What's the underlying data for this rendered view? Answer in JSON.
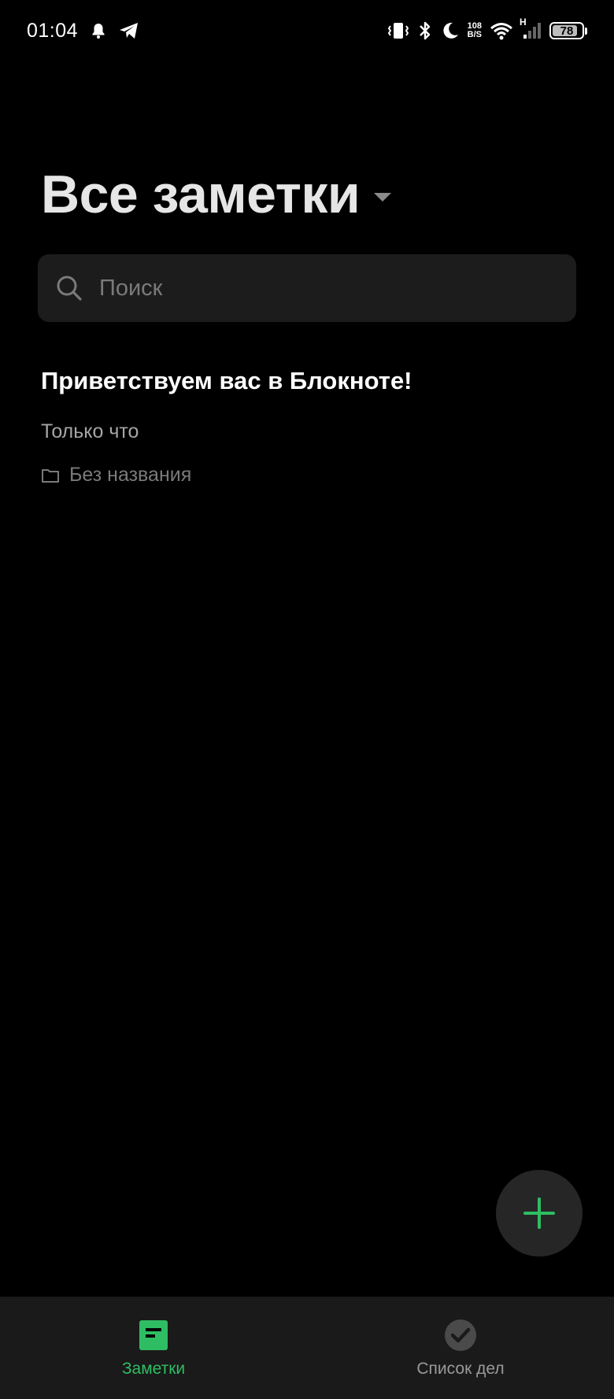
{
  "status_bar": {
    "time": "01:04",
    "net_speed_value": "108",
    "net_speed_unit": "B/S",
    "network_type": "H",
    "battery_level": "78",
    "icons": [
      "bell-icon",
      "telegram-icon",
      "vibrate-icon",
      "bluetooth-icon",
      "moon-icon",
      "wifi-icon",
      "signal-icon",
      "battery-icon"
    ]
  },
  "header": {
    "title": "Все заметки"
  },
  "search": {
    "placeholder": "Поиск",
    "value": ""
  },
  "notes": [
    {
      "title": "Приветствуем вас в Блокноте!",
      "time": "Только что",
      "folder": "Без названия"
    }
  ],
  "fab": {
    "icon": "plus-icon",
    "color": "#2ebd63"
  },
  "bottom_nav": {
    "items": [
      {
        "label": "Заметки",
        "icon": "notes-icon",
        "active": true
      },
      {
        "label": "Список дел",
        "icon": "checkmark-icon",
        "active": false
      }
    ]
  },
  "colors": {
    "accent": "#2ebd63",
    "background": "#000000",
    "surface": "#1c1c1c"
  }
}
